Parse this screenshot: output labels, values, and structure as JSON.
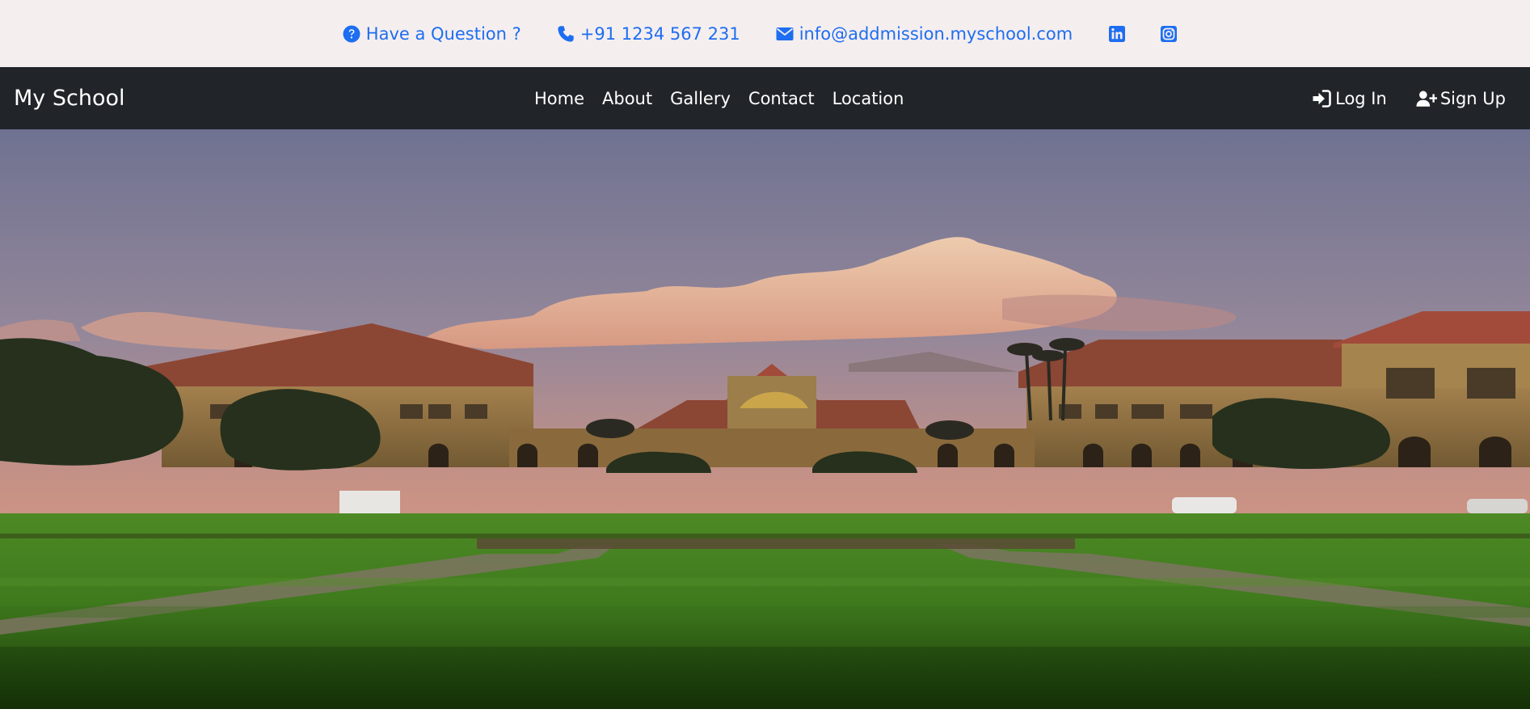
{
  "topbar": {
    "question_label": "Have a Question ?",
    "phone": "+91 1234 567 231",
    "email": "info@addmission.myschool.com",
    "icons": [
      "question-circle-icon",
      "phone-icon",
      "envelope-icon",
      "linkedin-icon",
      "instagram-icon"
    ],
    "accent_color": "#1d6ef0",
    "background_color": "#f5eeef"
  },
  "navbar": {
    "brand": "My School",
    "links": [
      "Home",
      "About",
      "Gallery",
      "Contact",
      "Location"
    ],
    "login_label": "Log In",
    "signup_label": "Sign Up",
    "background_color": "#212529"
  },
  "hero": {
    "image": "campus-photo"
  }
}
